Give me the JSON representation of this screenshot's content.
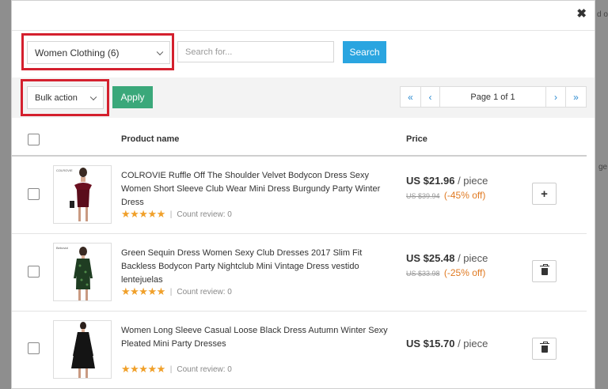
{
  "backdrop": {
    "fragment_1": "d o",
    "fragment_2": "ge"
  },
  "modal": {
    "close_glyph": "✖"
  },
  "filter": {
    "category_selected": "Women Clothing (6)",
    "search_placeholder": "Search for...",
    "search_button": "Search"
  },
  "toolbar": {
    "bulk_action_selected": "Bulk action",
    "apply_button": "Apply",
    "pager": {
      "first": "«",
      "prev": "‹",
      "page_label": "Page 1 of 1",
      "next": "›",
      "last": "»"
    }
  },
  "table": {
    "headers": {
      "product": "Product name",
      "price": "Price"
    },
    "rows": [
      {
        "thumb_tag": "COLROVIE",
        "name": "COLROVIE Ruffle Off The Shoulder Velvet Bodycon Dress Sexy Women Short Sleeve Club Wear Mini Dress Burgundy Party Winter Dress",
        "stars": "★★★★★",
        "separator": "|",
        "review": "Count review: 0",
        "price": "US $21.96",
        "unit": "/ piece",
        "old_price": "US $39.94",
        "discount": "(-45% off)",
        "action": "+",
        "action_icon": "plus-icon"
      },
      {
        "thumb_tag": "Bebovizi",
        "name": "Green Sequin Dress Women Sexy Club Dresses 2017 Slim Fit Backless Bodycon Party Nightclub Mini Vintage Dress vestido lentejuelas",
        "stars": "★★★★★",
        "separator": "|",
        "review": "Count review: 0",
        "price": "US $25.48",
        "unit": "/ piece",
        "old_price": "US $33.98",
        "discount": "(-25% off)",
        "action_icon": "trash-icon"
      },
      {
        "thumb_tag": "",
        "name": "Women Long Sleeve Casual Loose Black Dress Autumn Winter Sexy Pleated Mini Party Dresses",
        "stars": "★★★★★",
        "separator": "|",
        "review": "Count review: 0",
        "price": "US $15.70",
        "unit": "/ piece",
        "action_icon": "trash-icon"
      }
    ]
  },
  "colors": {
    "highlight_box": "#d4202e",
    "search_button": "#2aa5e0",
    "apply_button": "#3aa87a",
    "stars": "#f0a02a",
    "discount": "#e07a22",
    "pager_nav": "#2a8ad0"
  }
}
